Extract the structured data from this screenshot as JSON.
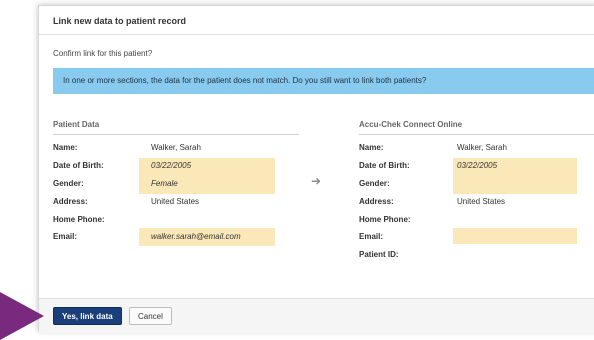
{
  "dialog": {
    "title": "Link new data to patient record",
    "confirm_text": "Confirm link for this patient?",
    "banner_text": "In one or more sections, the data for the patient does not match. Do you still want to link both patients?"
  },
  "left_panel": {
    "heading": "Patient Data",
    "fields": [
      {
        "label": "Name:",
        "value": "Walker, Sarah"
      },
      {
        "label": "Date of Birth:",
        "value": "03/22/2005"
      },
      {
        "label": "Gender:",
        "value": "Female"
      },
      {
        "label": "Address:",
        "value": "United States"
      },
      {
        "label": "Home Phone:",
        "value": ""
      },
      {
        "label": "Email:",
        "value": "walker.sarah@email.com"
      }
    ]
  },
  "right_panel": {
    "heading": "Accu-Chek Connect Online",
    "fields": [
      {
        "label": "Name:",
        "value": "Walker, Sarah"
      },
      {
        "label": "Date of Birth:",
        "value": "03/22/2005"
      },
      {
        "label": "Gender:",
        "value": ""
      },
      {
        "label": "Address:",
        "value": "United States"
      },
      {
        "label": "Home Phone:",
        "value": ""
      },
      {
        "label": "Email:",
        "value": ""
      },
      {
        "label": "Patient ID:",
        "value": ""
      }
    ]
  },
  "transfer_icon": "arrow-right-icon",
  "buttons": {
    "confirm_label": "Yes, link data",
    "cancel_label": "Cancel"
  },
  "colors": {
    "banner": "#88cbef",
    "mismatch_highlight": "#fbe8b8",
    "primary_button": "#1a3f7a",
    "pointer": "#7a2a7e"
  }
}
